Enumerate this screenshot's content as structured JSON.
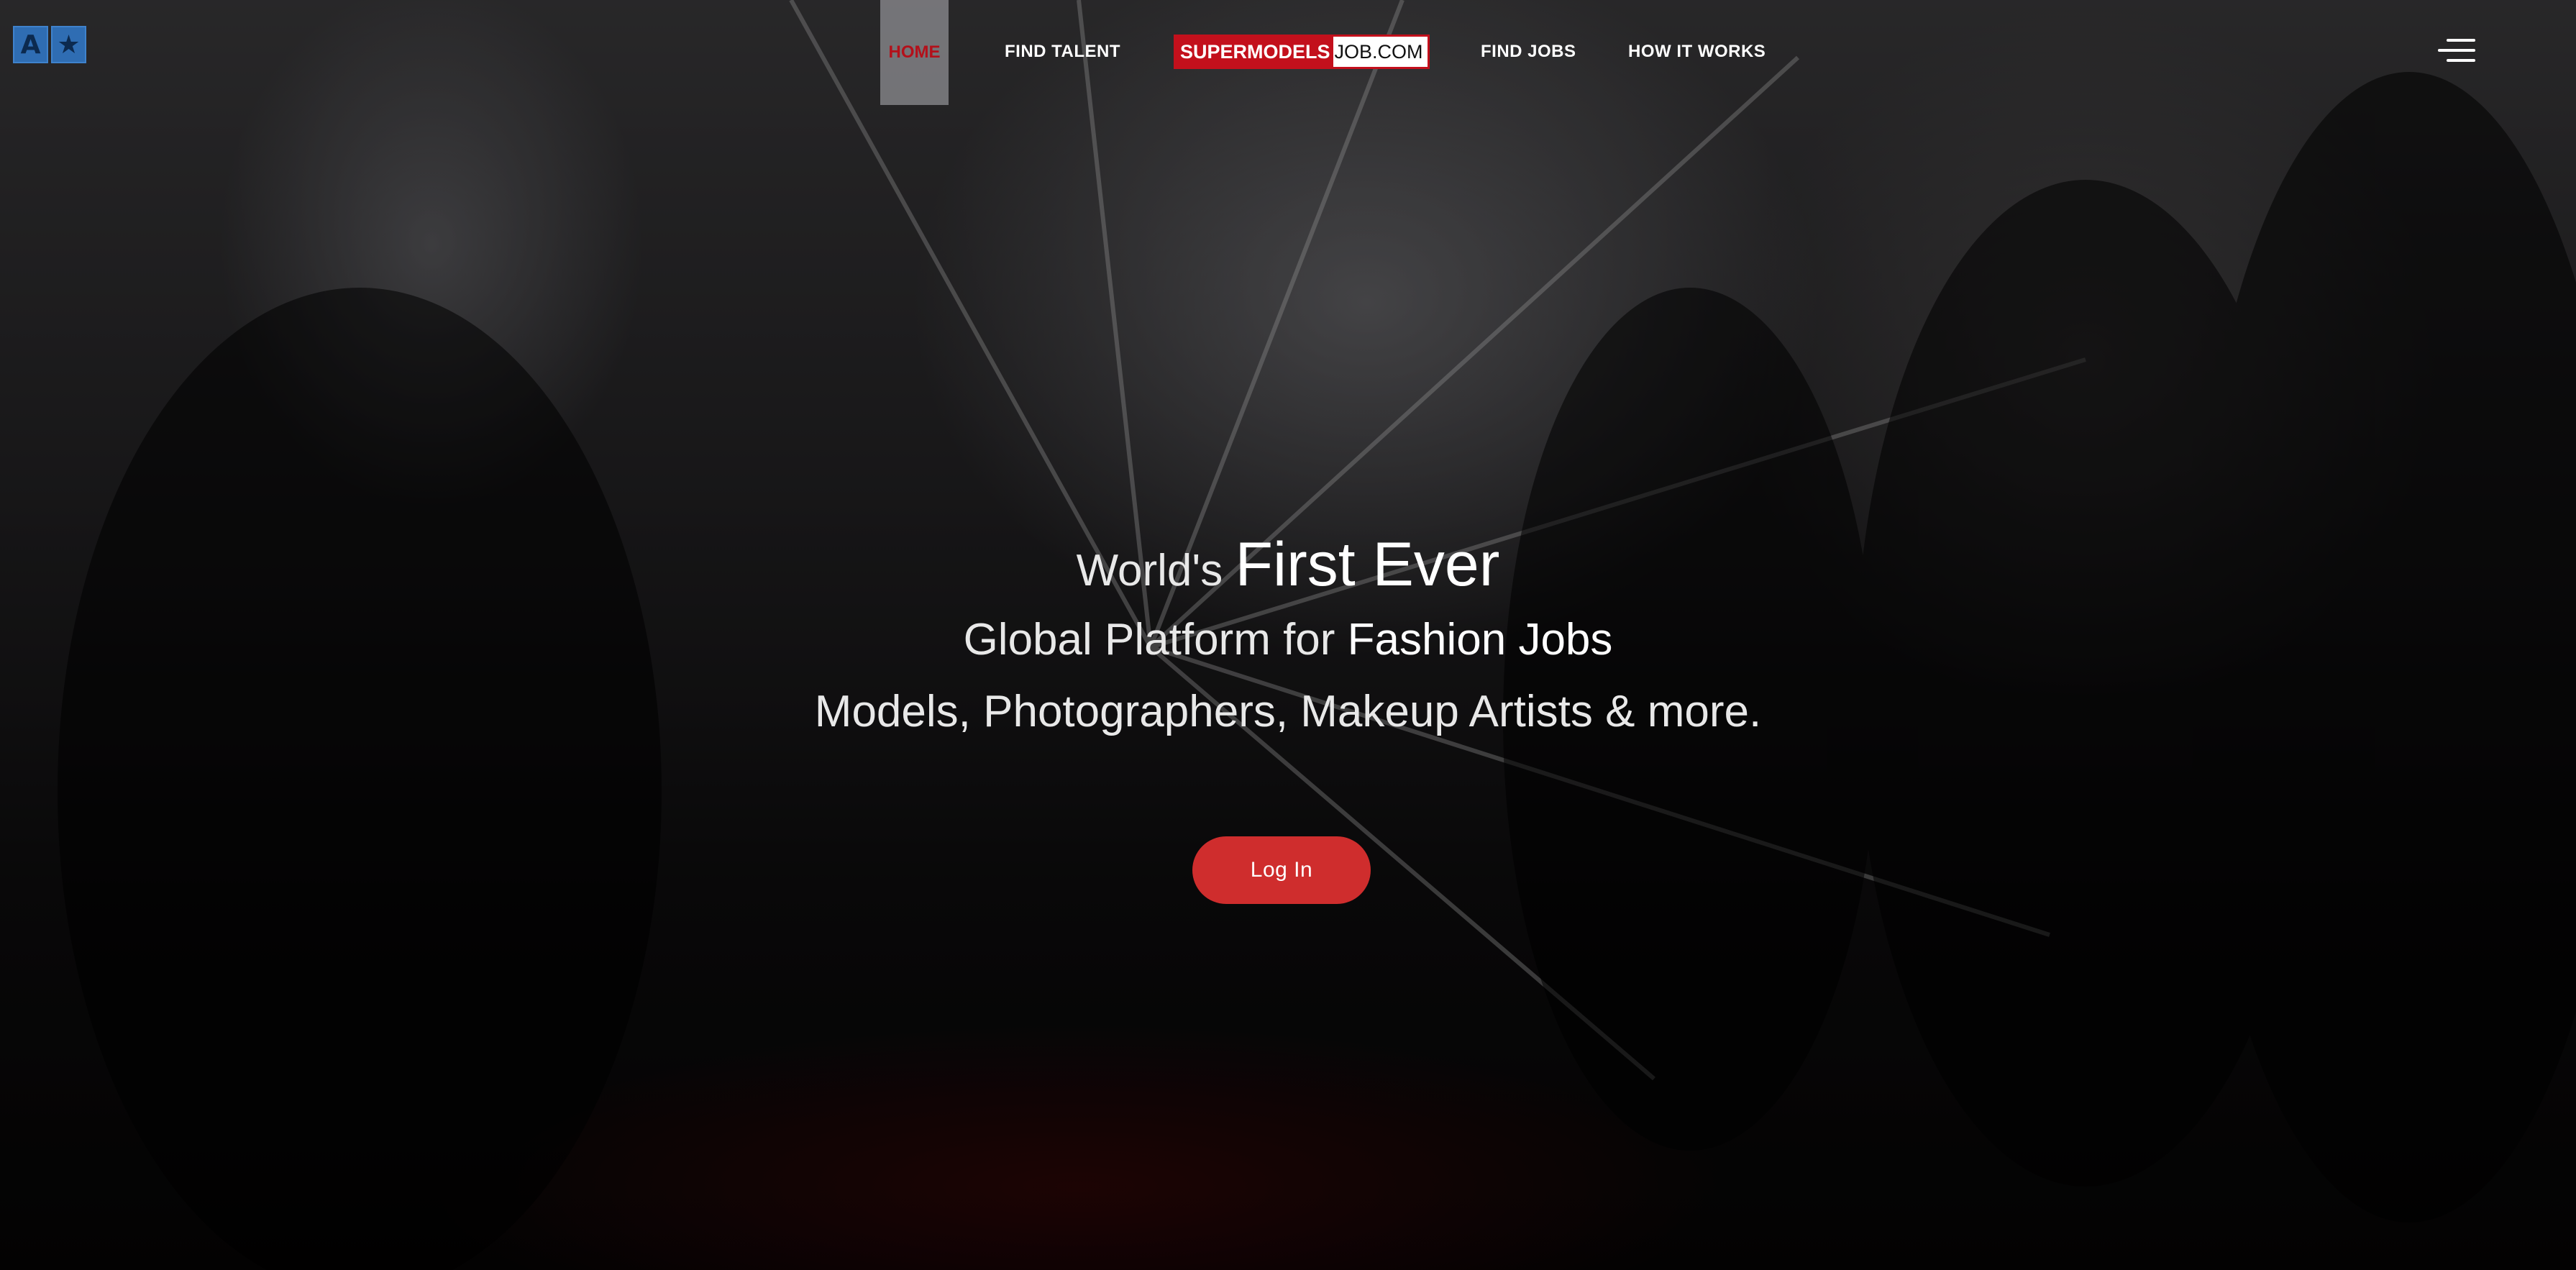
{
  "accessibility": {
    "letter": "A",
    "star": "★"
  },
  "nav": {
    "home": "HOME",
    "find_talent": "FIND TALENT",
    "find_jobs": "FIND JOBS",
    "how_it_works": "HOW IT WORKS"
  },
  "logo": {
    "red_part": "SUPERMODELS",
    "white_part": "JOB.COM"
  },
  "hero": {
    "line1_light": "World's ",
    "line1_bold": "First Ever",
    "line2_light": "Global Platform for ",
    "line2_bold": "Fashion Jobs",
    "line3": "Models, Photographers, Makeup Artists & more."
  },
  "login_button": "Log In",
  "colors": {
    "accent_red": "#c3101c",
    "button_red": "#cf2d2d",
    "widget_blue": "#2f6db3"
  }
}
